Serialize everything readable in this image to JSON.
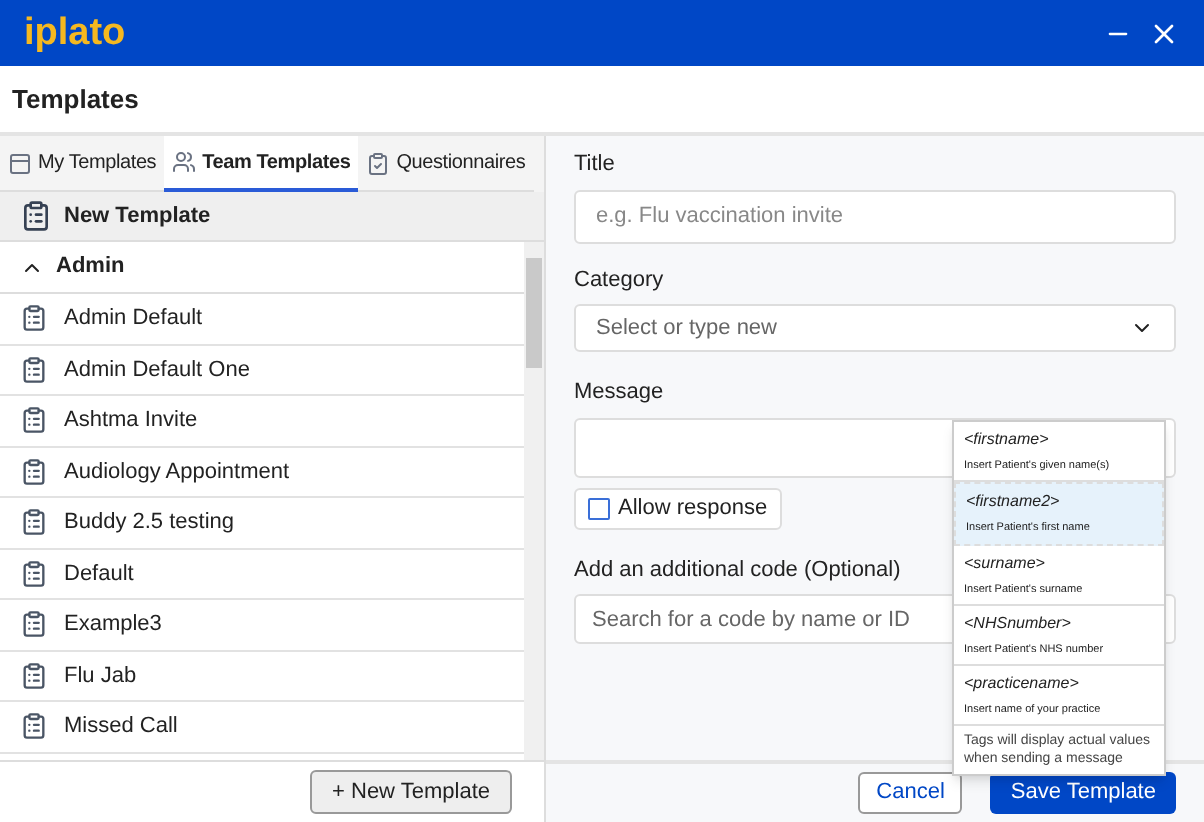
{
  "app": {
    "logo": "iplato"
  },
  "page_title": "Templates",
  "tabs": [
    {
      "label": "My Templates",
      "selected": false,
      "kind": "layout"
    },
    {
      "label": "Team Templates",
      "selected": true,
      "kind": "team"
    },
    {
      "label": "Questionnaires",
      "selected": false,
      "kind": "clipboard"
    }
  ],
  "new_template_row": "New Template",
  "group": {
    "label": "Admin",
    "expanded": true,
    "items": [
      {
        "label": "Admin Default"
      },
      {
        "label": "Admin Default One"
      },
      {
        "label": "Ashtma Invite"
      },
      {
        "label": "Audiology Appointment"
      },
      {
        "label": "Buddy 2.5 testing"
      },
      {
        "label": "Default"
      },
      {
        "label": "Example3"
      },
      {
        "label": "Flu Jab"
      },
      {
        "label": "Missed Call"
      }
    ]
  },
  "new_template_button": "+ New Template",
  "form": {
    "title": {
      "label": "Title",
      "placeholder": "e.g. Flu vaccination invite"
    },
    "category": {
      "label": "Category",
      "placeholder": "Select or type new"
    },
    "message": {
      "label": "Message"
    },
    "allow_response": {
      "label": "Allow response",
      "checked": false
    },
    "code": {
      "label": "Add an additional code (Optional)",
      "placeholder": "Search for a code by name or ID"
    }
  },
  "tag_menu": {
    "items": [
      {
        "tag": "<firstname>",
        "description": "Insert Patient's given name(s)",
        "selected": false
      },
      {
        "tag": "<firstname2>",
        "description": "Insert Patient's first name",
        "selected": true
      },
      {
        "tag": "<surname>",
        "description": "Insert Patient's surname",
        "selected": false
      },
      {
        "tag": "<NHSnumber>",
        "description": "Insert Patient's NHS number",
        "selected": false
      },
      {
        "tag": "<practicename>",
        "description": "Insert name of your practice",
        "selected": false
      }
    ],
    "note": "Tags will display actual values when sending a message"
  },
  "buttons": {
    "cancel": "Cancel",
    "save": "Save Template"
  }
}
